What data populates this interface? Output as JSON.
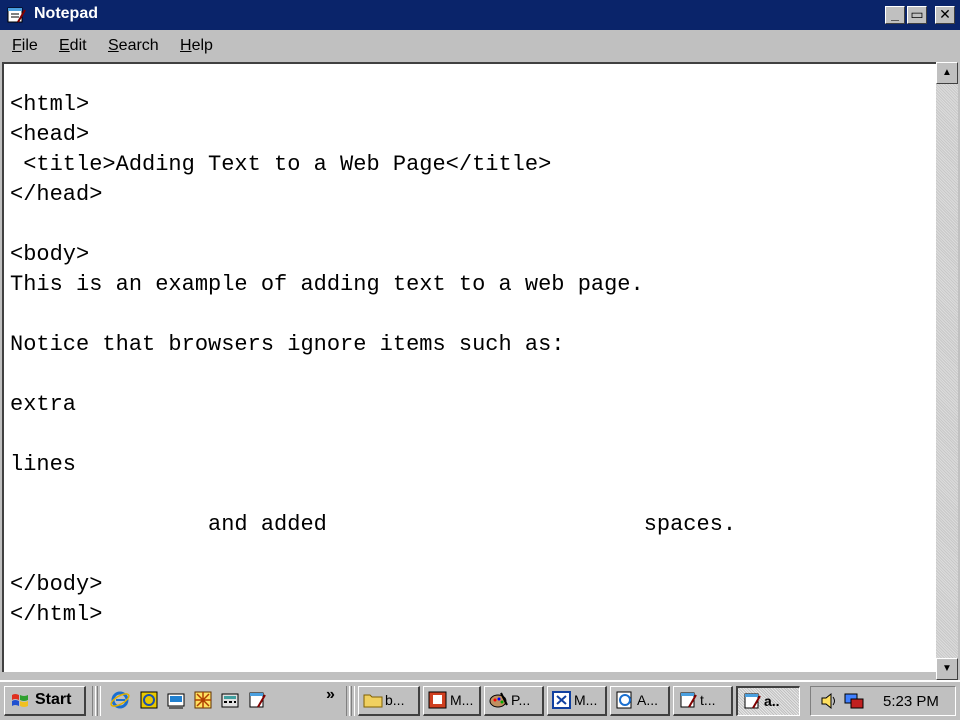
{
  "window": {
    "title": "Notepad",
    "minimize_glyph": "_",
    "maximize_glyph": "▭",
    "close_glyph": "✕"
  },
  "menu": [
    {
      "label": "File",
      "accel": "F",
      "rest": "ile"
    },
    {
      "label": "Edit",
      "accel": "E",
      "rest": "dit"
    },
    {
      "label": "Search",
      "accel": "S",
      "rest": "earch"
    },
    {
      "label": "Help",
      "accel": "H",
      "rest": "elp"
    }
  ],
  "editor": {
    "lines": [
      "<html>",
      "<head>",
      " <title>Adding Text to a Web Page</title>",
      "</head>",
      "",
      "<body>",
      "This is an example of adding text to a web page.",
      "",
      "Notice that browsers ignore items such as:",
      "",
      "extra",
      "",
      "lines",
      "",
      "               and added                        spaces.",
      "",
      "</body>",
      "</html>"
    ]
  },
  "scrollbar": {
    "up_glyph": "▲",
    "down_glyph": "▼"
  },
  "taskbar": {
    "start_label": "Start",
    "overflow_glyph": "»",
    "quick_launch": [
      "internet-explorer-icon",
      "outlook-icon",
      "show-desktop-icon",
      "channels-icon",
      "calculator-icon",
      "notepad-icon"
    ],
    "tasks": [
      {
        "label": "b...",
        "icon": "folder-icon"
      },
      {
        "label": "M...",
        "icon": "powerpoint-icon"
      },
      {
        "label": "P...",
        "icon": "paint-icon"
      },
      {
        "label": "M...",
        "icon": "window-icon"
      },
      {
        "label": "A...",
        "icon": "internet-explorer-icon"
      },
      {
        "label": "t...",
        "icon": "notepad-icon"
      },
      {
        "label": "a..",
        "icon": "notepad-icon",
        "active": true
      }
    ],
    "clock": "5:23 PM"
  }
}
